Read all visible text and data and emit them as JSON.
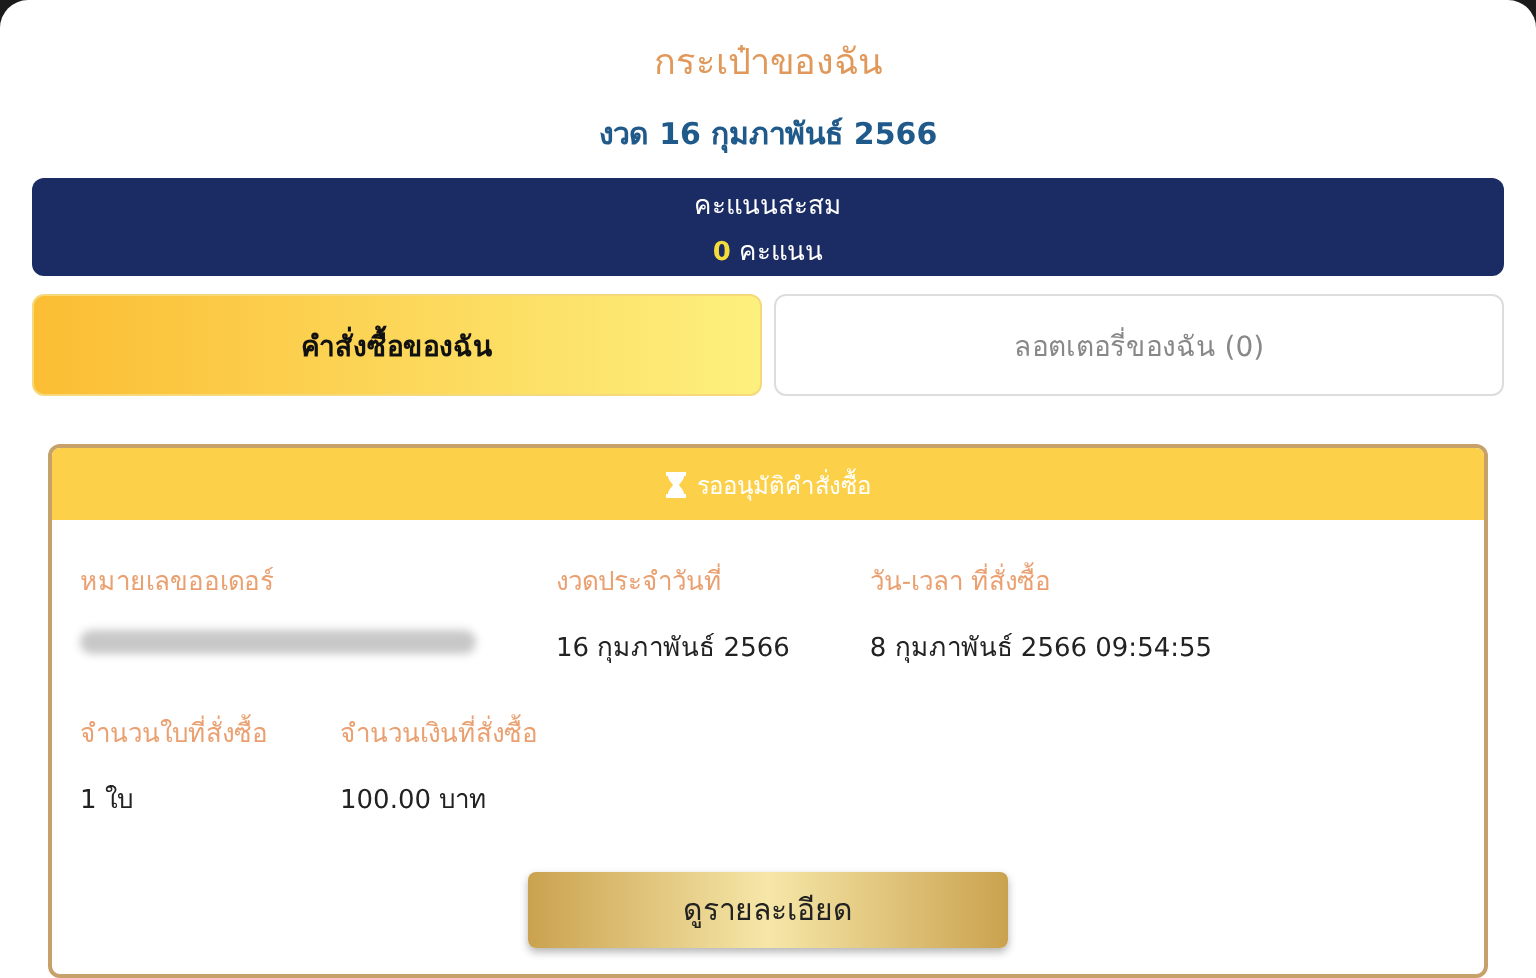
{
  "title": "กระเป๋าของฉัน",
  "draw_label": "งวด 16 กุมภาพันธ์ 2566",
  "points": {
    "label": "คะแนนสะสม",
    "value": "0",
    "unit": "คะแนน"
  },
  "tabs": [
    {
      "label": "คำสั่งซื้อของฉัน",
      "selected": true
    },
    {
      "label": "ลอตเตอรี่ของฉัน (0)",
      "selected": false
    }
  ],
  "order": {
    "status": "รออนุมัติคำสั่งซื้อ",
    "fields": [
      {
        "label": "หมายเลขออเดอร์",
        "kind": "redacted"
      },
      {
        "label": "งวดประจำวันที่",
        "value": "16 กุมภาพันธ์ 2566",
        "kind": "text"
      },
      {
        "label": "วัน-เวลา ที่สั่งซื้อ",
        "value": "8 กุมภาพันธ์ 2566 09:54:55",
        "kind": "text"
      },
      {
        "label": "จำนวนใบที่สั่งซื้อ",
        "value": "1 ใบ",
        "kind": "text"
      },
      {
        "label": "จำนวนเงินที่สั่งซื้อ",
        "value": "100.00 บาท",
        "kind": "text"
      }
    ],
    "button": "ดูรายละเอียด"
  }
}
